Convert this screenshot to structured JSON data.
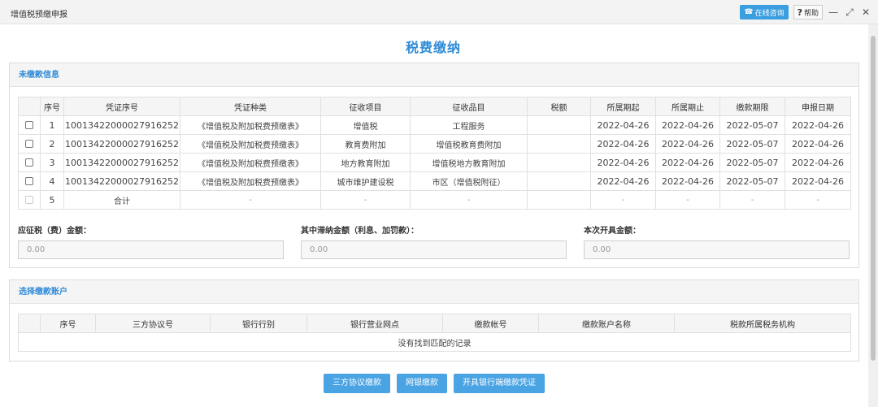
{
  "window": {
    "title": "增值税预缴申报",
    "consult_label": "在线咨询",
    "help_label": "帮助",
    "help_glyph": "?",
    "min_glyph": "—",
    "max_glyph": "⤢",
    "close_glyph": "✕",
    "consult_glyph": "☎"
  },
  "page": {
    "title": "税费缴纳"
  },
  "unpaid": {
    "section_title": "未缴款信息",
    "headers": [
      "",
      "序号",
      "凭证序号",
      "凭证种类",
      "征收项目",
      "征收品目",
      "税额",
      "所属期起",
      "所属期止",
      "缴款期限",
      "申报日期"
    ],
    "rows": [
      {
        "seq": "1",
        "voucher_no": "10013422000027916252",
        "voucher_type": "《增值税及附加税费预缴表》",
        "item": "增值税",
        "sub_item": "工程服务",
        "tax": "",
        "start": "2022-04-26",
        "end": "2022-04-26",
        "deadline": "2022-05-07",
        "declared": "2022-04-26"
      },
      {
        "seq": "2",
        "voucher_no": "10013422000027916252",
        "voucher_type": "《增值税及附加税费预缴表》",
        "item": "教育费附加",
        "sub_item": "增值税教育费附加",
        "tax": "",
        "start": "2022-04-26",
        "end": "2022-04-26",
        "deadline": "2022-05-07",
        "declared": "2022-04-26"
      },
      {
        "seq": "3",
        "voucher_no": "10013422000027916252",
        "voucher_type": "《增值税及附加税费预缴表》",
        "item": "地方教育附加",
        "sub_item": "增值税地方教育附加",
        "tax": "",
        "start": "2022-04-26",
        "end": "2022-04-26",
        "deadline": "2022-05-07",
        "declared": "2022-04-26"
      },
      {
        "seq": "4",
        "voucher_no": "10013422000027916252",
        "voucher_type": "《增值税及附加税费预缴表》",
        "item": "城市维护建设税",
        "sub_item": "市区（增值税附征）",
        "tax": "",
        "start": "2022-04-26",
        "end": "2022-04-26",
        "deadline": "2022-05-07",
        "declared": "2022-04-26"
      }
    ],
    "total_row": {
      "seq": "5",
      "voucher_no": "合计",
      "voucher_type": "-",
      "item": "-",
      "sub_item": "-",
      "tax": "",
      "start": "-",
      "end": "-",
      "deadline": "-",
      "declared": "-"
    }
  },
  "amounts": {
    "due_label": "应征税（费）金额：",
    "due_value": "0.00",
    "late_label": "其中滞纳金额（利息、加罚款）：",
    "late_value": "0.00",
    "issue_label": "本次开具金额：",
    "issue_value": "0.00"
  },
  "account": {
    "section_title": "选择缴款账户",
    "headers": [
      "",
      "序号",
      "三方协议号",
      "银行行别",
      "银行营业网点",
      "缴款帐号",
      "缴款账户名称",
      "税款所属税务机构"
    ],
    "empty_text": "没有找到匹配的记录"
  },
  "buttons": {
    "tripartite": "三方协议缴款",
    "online_bank": "网银缴款",
    "bank_voucher": "开具银行端缴款凭证"
  },
  "colors": {
    "accent": "#2e8bd8",
    "button": "#4aa3e3"
  }
}
